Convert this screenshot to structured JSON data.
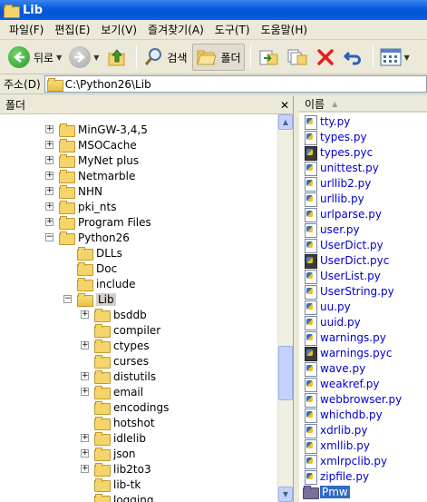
{
  "window": {
    "title": "Lib"
  },
  "menu": [
    "파일(F)",
    "편집(E)",
    "보기(V)",
    "즐겨찾기(A)",
    "도구(T)",
    "도움말(H)"
  ],
  "toolbar": {
    "back_label": "뒤로",
    "search_label": "검색",
    "folders_label": "폴더"
  },
  "address": {
    "label": "주소(D)",
    "value": "C:\\Python26\\Lib"
  },
  "folder_pane": {
    "title": "폴더",
    "close": "✕",
    "items": [
      {
        "label": "MinGW-3,4,5",
        "level": 0,
        "expander": "+"
      },
      {
        "label": "MSOCache",
        "level": 0,
        "expander": "+"
      },
      {
        "label": "MyNet plus",
        "level": 0,
        "expander": "+"
      },
      {
        "label": "Netmarble",
        "level": 0,
        "expander": "+"
      },
      {
        "label": "NHN",
        "level": 0,
        "expander": "+"
      },
      {
        "label": "pki_nts",
        "level": 0,
        "expander": "+"
      },
      {
        "label": "Program Files",
        "level": 0,
        "expander": "+"
      },
      {
        "label": "Python26",
        "level": 0,
        "expander": "-"
      },
      {
        "label": "DLLs",
        "level": 1,
        "expander": ""
      },
      {
        "label": "Doc",
        "level": 1,
        "expander": ""
      },
      {
        "label": "include",
        "level": 1,
        "expander": ""
      },
      {
        "label": "Lib",
        "level": 1,
        "expander": "-",
        "selected": true
      },
      {
        "label": "bsddb",
        "level": 2,
        "expander": "+"
      },
      {
        "label": "compiler",
        "level": 2,
        "expander": ""
      },
      {
        "label": "ctypes",
        "level": 2,
        "expander": "+"
      },
      {
        "label": "curses",
        "level": 2,
        "expander": ""
      },
      {
        "label": "distutils",
        "level": 2,
        "expander": "+"
      },
      {
        "label": "email",
        "level": 2,
        "expander": "+"
      },
      {
        "label": "encodings",
        "level": 2,
        "expander": ""
      },
      {
        "label": "hotshot",
        "level": 2,
        "expander": ""
      },
      {
        "label": "idlelib",
        "level": 2,
        "expander": "+"
      },
      {
        "label": "json",
        "level": 2,
        "expander": "+"
      },
      {
        "label": "lib2to3",
        "level": 2,
        "expander": "+"
      },
      {
        "label": "lib-tk",
        "level": 2,
        "expander": ""
      },
      {
        "label": "logging",
        "level": 2,
        "expander": ""
      }
    ]
  },
  "file_list": {
    "column_name": "이름",
    "files": [
      {
        "name": "tty.py",
        "type": "py"
      },
      {
        "name": "types.py",
        "type": "py"
      },
      {
        "name": "types.pyc",
        "type": "pyc"
      },
      {
        "name": "unittest.py",
        "type": "py"
      },
      {
        "name": "urllib2.py",
        "type": "py"
      },
      {
        "name": "urllib.py",
        "type": "py"
      },
      {
        "name": "urlparse.py",
        "type": "py"
      },
      {
        "name": "user.py",
        "type": "py"
      },
      {
        "name": "UserDict.py",
        "type": "py"
      },
      {
        "name": "UserDict.pyc",
        "type": "pyc"
      },
      {
        "name": "UserList.py",
        "type": "py"
      },
      {
        "name": "UserString.py",
        "type": "py"
      },
      {
        "name": "uu.py",
        "type": "py"
      },
      {
        "name": "uuid.py",
        "type": "py"
      },
      {
        "name": "warnings.py",
        "type": "py"
      },
      {
        "name": "warnings.pyc",
        "type": "pyc"
      },
      {
        "name": "wave.py",
        "type": "py"
      },
      {
        "name": "weakref.py",
        "type": "py"
      },
      {
        "name": "webbrowser.py",
        "type": "py"
      },
      {
        "name": "whichdb.py",
        "type": "py"
      },
      {
        "name": "xdrlib.py",
        "type": "py"
      },
      {
        "name": "xmllib.py",
        "type": "py"
      },
      {
        "name": "xmlrpclib.py",
        "type": "py"
      },
      {
        "name": "zipfile.py",
        "type": "py"
      },
      {
        "name": "Pmw",
        "type": "dir",
        "selected": true
      }
    ]
  }
}
